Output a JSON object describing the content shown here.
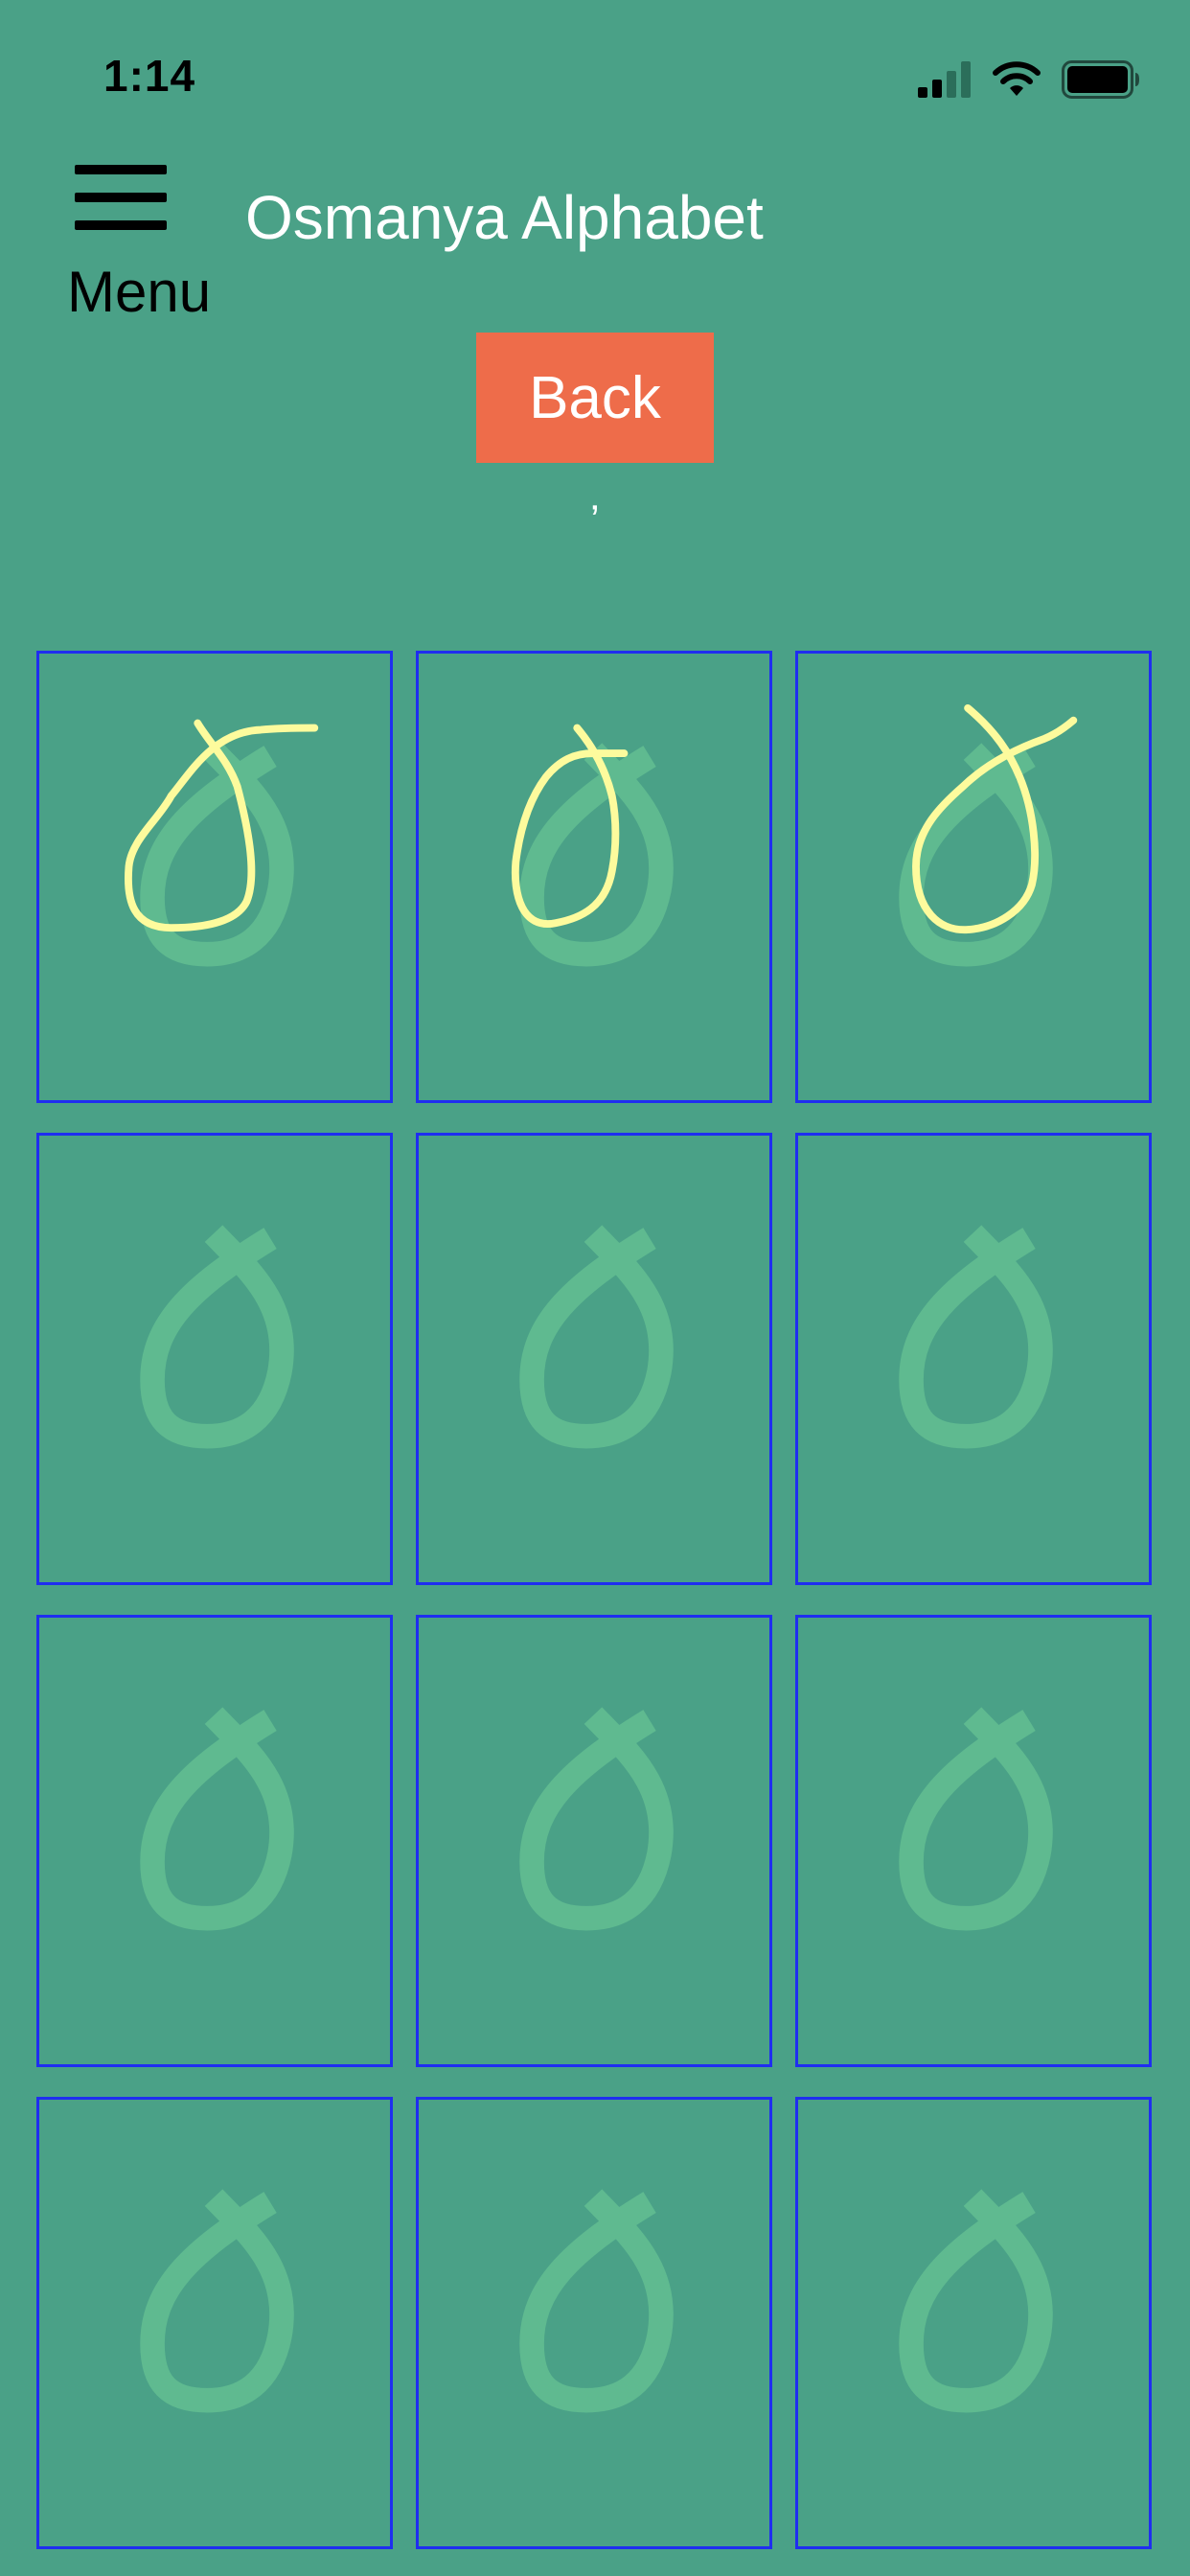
{
  "status_bar": {
    "time": "1:14",
    "icons": [
      "cellular-signal-icon",
      "wifi-icon",
      "battery-icon"
    ]
  },
  "header": {
    "menu_label": "Menu",
    "title": "Osmanya Alphabet"
  },
  "back_label": "Back",
  "letter_name": "ʼ",
  "practice": {
    "cell_count": 12,
    "traced_count": 3,
    "guide_glyph": "osmanya-letter-alef-guide",
    "colors": {
      "background": "#4aa187",
      "guide": "#5fba90",
      "trace": "#fdfb9d",
      "cell_border": "#1f2ef0",
      "back_button": "#ee6c4a"
    }
  }
}
